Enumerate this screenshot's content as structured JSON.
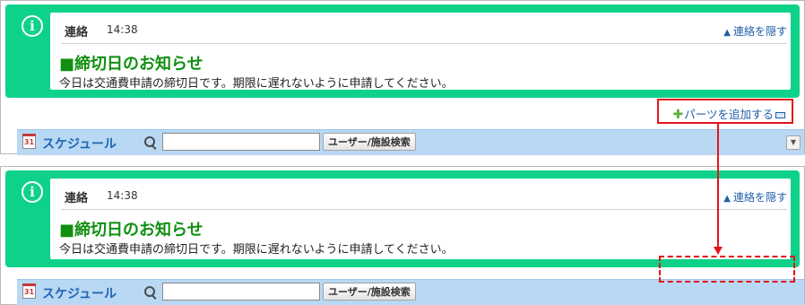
{
  "notice": {
    "category": "連絡",
    "time": "14:38",
    "hide_link": "連絡を隠す",
    "title": "■締切日のお知らせ",
    "body": "今日は交通費申請の締切日です。期限に遅れないように申請してください。"
  },
  "add_parts": {
    "label": "パーツを追加する"
  },
  "toolbar": {
    "schedule_label": "スケジュール",
    "search_value": "",
    "search_button": "ユーザー/施設検索",
    "calendar_day": "31"
  },
  "colors": {
    "notice_bg": "#0fd28a",
    "title_green": "#108f10",
    "link_blue": "#1f5ea8",
    "toolbar_bg": "#b8d8f3",
    "highlight_red": "#e3141a"
  },
  "icons": {
    "info": "info-icon",
    "triangle": "triangle-up-icon",
    "plus": "plus-icon",
    "minus": "minus-icon",
    "calendar": "calendar-icon",
    "search": "search-icon",
    "menu": "chevron-down-icon"
  }
}
